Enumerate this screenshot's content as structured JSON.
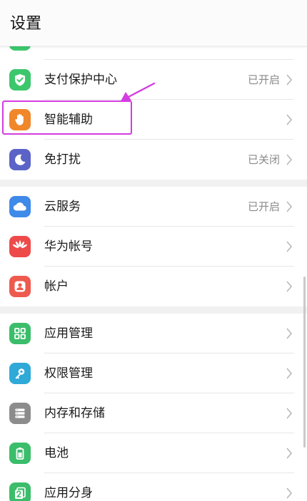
{
  "header": {
    "title": "设置"
  },
  "rows": [
    {
      "label": "",
      "status": ""
    },
    {
      "label": "支付保护中心",
      "status": "已开启"
    },
    {
      "label": "智能辅助",
      "status": ""
    },
    {
      "label": "免打扰",
      "status": "已关闭"
    },
    {
      "label": "云服务",
      "status": "已开启"
    },
    {
      "label": "华为帐号",
      "status": ""
    },
    {
      "label": "帐户",
      "status": ""
    },
    {
      "label": "应用管理",
      "status": ""
    },
    {
      "label": "权限管理",
      "status": ""
    },
    {
      "label": "内存和存储",
      "status": ""
    },
    {
      "label": "电池",
      "status": ""
    },
    {
      "label": "应用分身",
      "status": ""
    }
  ],
  "colors": {
    "highlight": "#d43de0",
    "payment_icon": "#3cc76c",
    "assist_icon": "#f0872a",
    "dnd_icon": "#5b63c7",
    "cloud_icon": "#3f8ae8",
    "huawei_icon": "#ee4a4a",
    "account_icon": "#ee5a4e",
    "apps_icon": "#3bbd6b",
    "permission_icon": "#2fa9d8",
    "storage_icon": "#8c8c8c",
    "battery_icon": "#3bbd6b",
    "clone_icon": "#3bbd6b"
  },
  "icons": [
    "partial-icon",
    "shield-check-icon",
    "hand-icon",
    "moon-icon",
    "cloud-icon",
    "huawei-logo-icon",
    "person-icon",
    "grid-apps-icon",
    "key-icon",
    "storage-icon",
    "battery-icon",
    "app-clone-icon"
  ]
}
